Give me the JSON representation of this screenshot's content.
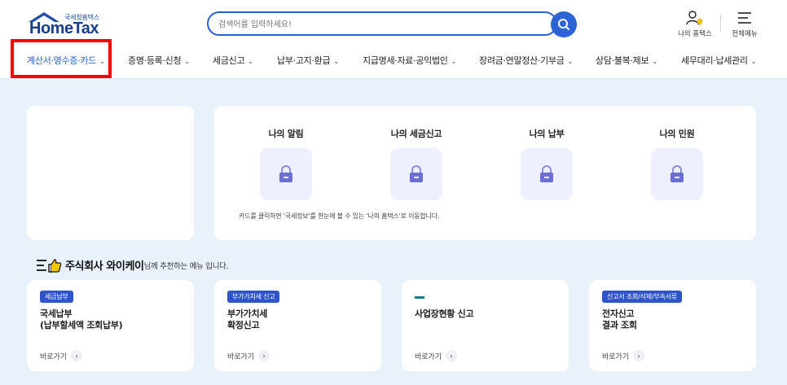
{
  "header": {
    "logo_sub": "국세청홈택스",
    "logo_main": "HomeTax",
    "search_placeholder": "검색어를 입력하세요!",
    "my_hometax": "나의 홈택스",
    "all_menu": "전체메뉴"
  },
  "nav": {
    "items": [
      {
        "label": "계산서·영수증·카드"
      },
      {
        "label": "증명·등록·신청"
      },
      {
        "label": "세금신고"
      },
      {
        "label": "납부·고지·환급"
      },
      {
        "label": "지급명세·자료·공익법인"
      },
      {
        "label": "장려금·연말정산·기부금"
      },
      {
        "label": "상담·불복·제보"
      },
      {
        "label": "세무대리·납세관리"
      }
    ]
  },
  "my_cards": {
    "items": [
      {
        "label": "나의 알림",
        "icon": "lock-icon"
      },
      {
        "label": "나의 세금신고",
        "icon": "lock-icon"
      },
      {
        "label": "나의 납부",
        "icon": "lock-icon"
      },
      {
        "label": "나의 민원",
        "icon": "lock-icon"
      }
    ],
    "note": "카드를 클릭하면 '국세정보'를 한눈에 볼 수 있는 '나의 홈택스'로 이동합니다."
  },
  "recommend": {
    "name": "주식회사 와이케이",
    "suffix": "님께 추천하는 메뉴 입니다."
  },
  "menu_cards": [
    {
      "badge": "세금납부",
      "title": "국세납부\n(납부할세액 조회납부)",
      "link": "바로가기"
    },
    {
      "badge": "부가가치세 신고",
      "title": "부가가치세\n확정신고",
      "link": "바로가기"
    },
    {
      "badge": "",
      "title": "사업장현황 신고",
      "link": "바로가기"
    },
    {
      "badge": "신고서 조회/삭제/부속서류",
      "title": "전자신고\n결과 조회",
      "link": "바로가기"
    }
  ],
  "colors": {
    "accent": "#2c64d8",
    "highlight": "#ff0000",
    "background": "#e9f2fb",
    "badge": "#2d55c9"
  }
}
